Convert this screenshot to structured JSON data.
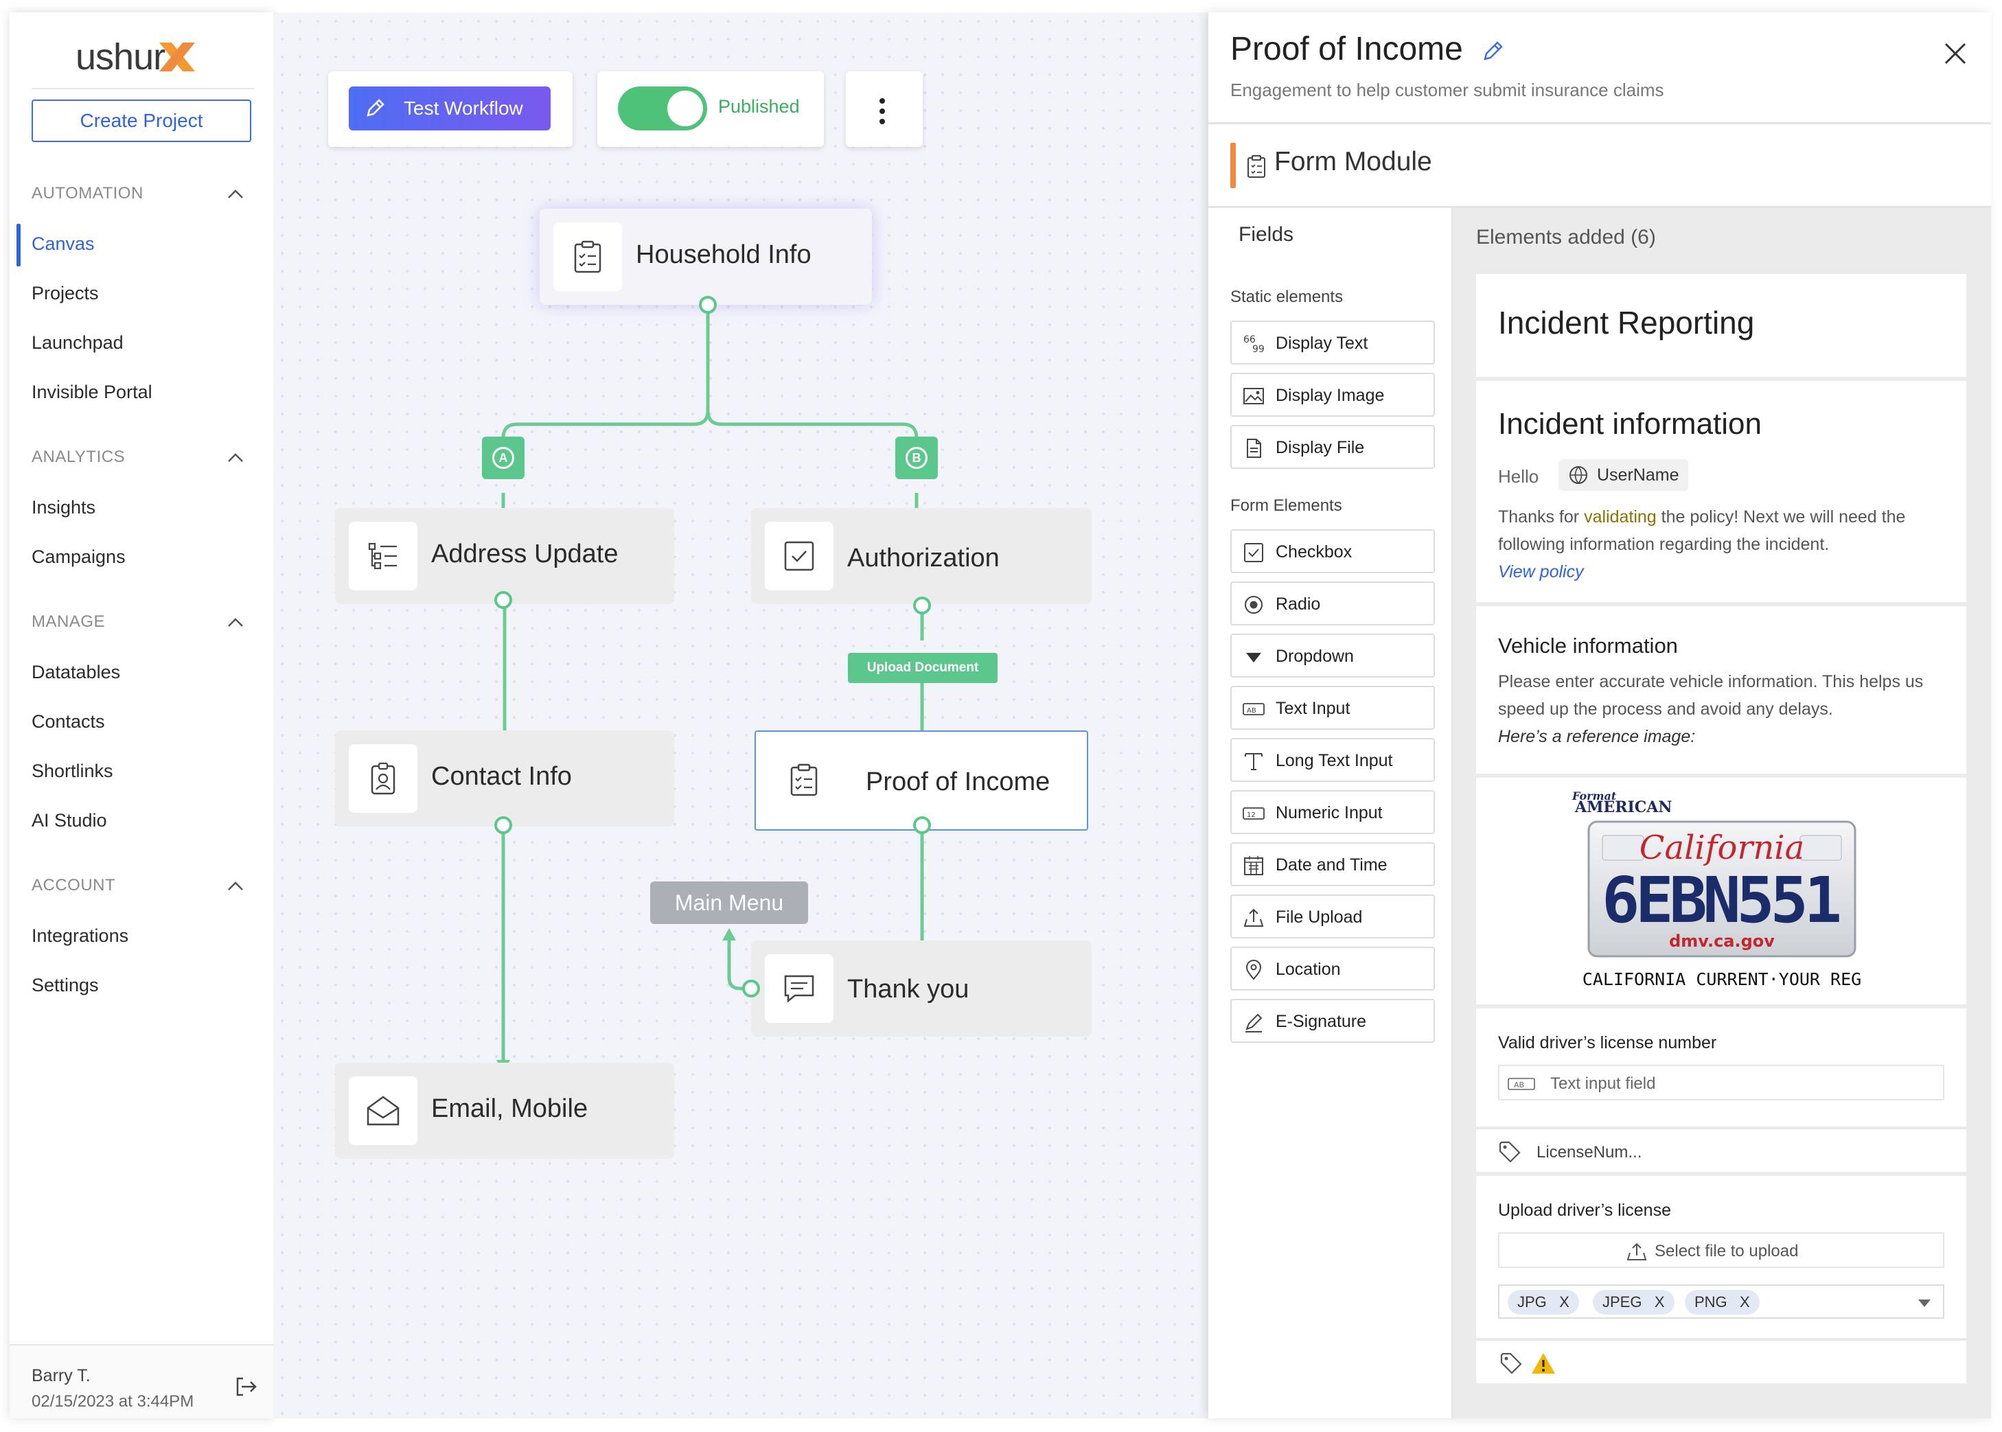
{
  "brand": {
    "name": "ushur"
  },
  "sidebar": {
    "create_label": "Create Project",
    "sections": [
      {
        "title": "AUTOMATION",
        "items": [
          "Canvas",
          "Projects",
          "Launchpad",
          "Invisible Portal"
        ]
      },
      {
        "title": "ANALYTICS",
        "items": [
          "Insights",
          "Campaigns"
        ]
      },
      {
        "title": "MANAGE",
        "items": [
          "Datatables",
          "Contacts",
          "Shortlinks",
          "AI Studio"
        ]
      },
      {
        "title": "ACCOUNT",
        "items": [
          "Integrations",
          "Settings"
        ]
      }
    ],
    "active_item": "Canvas",
    "user": {
      "name": "Barry T.",
      "timestamp": "02/15/2023 at 3:44PM"
    }
  },
  "toolbar": {
    "test_label": "Test Workflow",
    "published_label": "Published",
    "published": true
  },
  "workflow": {
    "nodes": {
      "household": "Household Info",
      "address": "Address Update",
      "authorization": "Authorization",
      "contact": "Contact Info",
      "proof": "Proof of Income",
      "thankyou": "Thank you",
      "email": "Email, Mobile"
    },
    "branch_a": "A",
    "branch_b": "B",
    "upload_doc": "Upload Document",
    "main_menu": "Main Menu"
  },
  "panel": {
    "title": "Proof of Income",
    "subtitle": "Engagement to help customer submit insurance claims",
    "module": "Form Module",
    "fields_title": "Fields",
    "static_label": "Static elements",
    "static_items": [
      "Display Text",
      "Display Image",
      "Display File"
    ],
    "form_label": "Form Elements",
    "form_items": [
      "Checkbox",
      "Radio",
      "Dropdown",
      "Text Input",
      "Long Text Input",
      "Numeric Input",
      "Date and Time",
      "File Upload",
      "Location",
      "E-Signature"
    ],
    "elements_title": "Elements added (6)",
    "cards": {
      "reporting_title": "Incident Reporting",
      "info_title": "Incident information",
      "hello": "Hello",
      "username": "UserName",
      "thanks_pre": "Thanks for ",
      "thanks_hl": "validating",
      "thanks_post": " the policy! Next we will need the following information regarding the incident.",
      "view_policy": "View policy",
      "vehicle_title": "Vehicle information",
      "vehicle_text": "Please enter accurate vehicle information. This helps us speed up the process and avoid any delays.",
      "reference": "Here’s a reference image:",
      "plate": {
        "top": "Format",
        "brand": "AMERICAN",
        "state": "California",
        "number": "6EBN551",
        "site": "dmv.ca.gov",
        "caption": "CALIFORNIA CURRENT·YOUR REG"
      },
      "license_label": "Valid driver’s license number",
      "license_placeholder": "Text input field",
      "license_tag": "LicenseNum...",
      "upload_label": "Upload driver’s license",
      "upload_text": "Select file to upload",
      "file_types": [
        "JPG",
        "JPEG",
        "PNG"
      ],
      "remove": "X"
    }
  },
  "colors": {
    "accent": "#2f63d8",
    "flow": "#5cc78c",
    "module": "#f08a3c"
  }
}
